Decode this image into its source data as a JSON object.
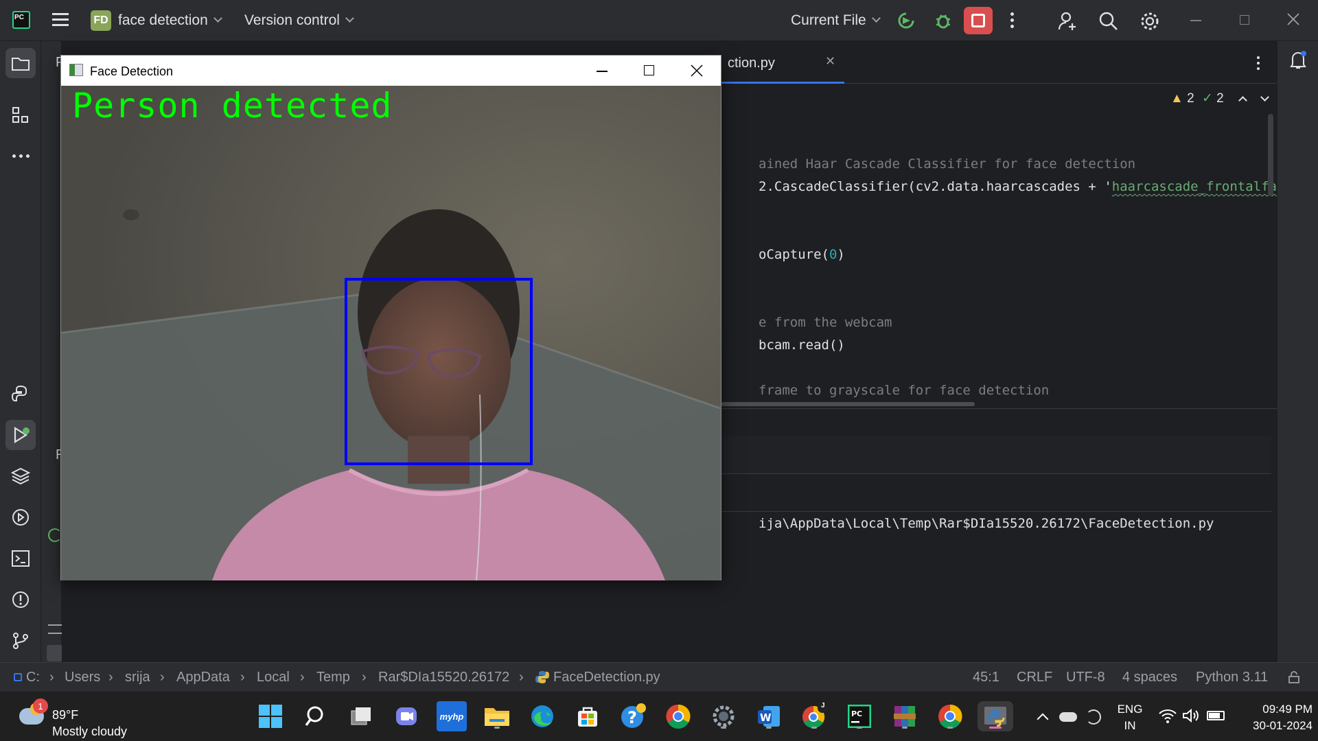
{
  "titlebar": {
    "project_badge": "FD",
    "project_name": "face detection",
    "vcs": "Version control",
    "run_config": "Current File"
  },
  "editor": {
    "tab_label": "ction.py",
    "warnings_count": "2",
    "checks_count": "2",
    "code_lines": [
      {
        "pre": "",
        "cmt": "ained Haar Cascade Classifier for face detection",
        "rest": ""
      },
      {
        "pre": "2.CascadeClassifier(cv2.data.haarcascades + '",
        "str": "haarcascade_frontalface",
        "rest": ""
      },
      {
        "pre": "oCapture(",
        "num": "0",
        "rest": ")"
      },
      {
        "pre": "",
        "cmt": "e from the webcam",
        "rest": ""
      },
      {
        "pre": "bcam.read()",
        "rest": ""
      },
      {
        "pre": "",
        "cmt": "frame to grayscale for face detection",
        "rest": ""
      }
    ],
    "run_output": "ija\\AppData\\Local\\Temp\\Rar$DIa15520.26172\\FaceDetection.py",
    "partial_left_labels": [
      "P",
      "R"
    ]
  },
  "fd_window": {
    "title": "Face Detection",
    "overlay_text": "Person detected",
    "overlay_color": "#00ff00",
    "box_color": "#0000ff"
  },
  "statusbar": {
    "breadcrumbs": [
      "C:",
      "Users",
      "srija",
      "AppData",
      "Local",
      "Temp",
      "Rar$DIa15520.26172",
      "FaceDetection.py"
    ],
    "position": "45:1",
    "line_sep": "CRLF",
    "encoding": "UTF-8",
    "indent": "4 spaces",
    "interpreter": "Python 3.11"
  },
  "taskbar": {
    "weather_temp": "89°F",
    "weather_desc": "Mostly cloudy",
    "weather_badge": "1",
    "lang_top": "ENG",
    "lang_bottom": "IN",
    "time": "09:49 PM",
    "date": "30-01-2024",
    "chrome_badge": "J"
  },
  "colors": {
    "ide_bg": "#1e1f22",
    "ide_panel": "#2b2d30",
    "stop_red": "#e06c75",
    "run_green": "#5fb865"
  }
}
